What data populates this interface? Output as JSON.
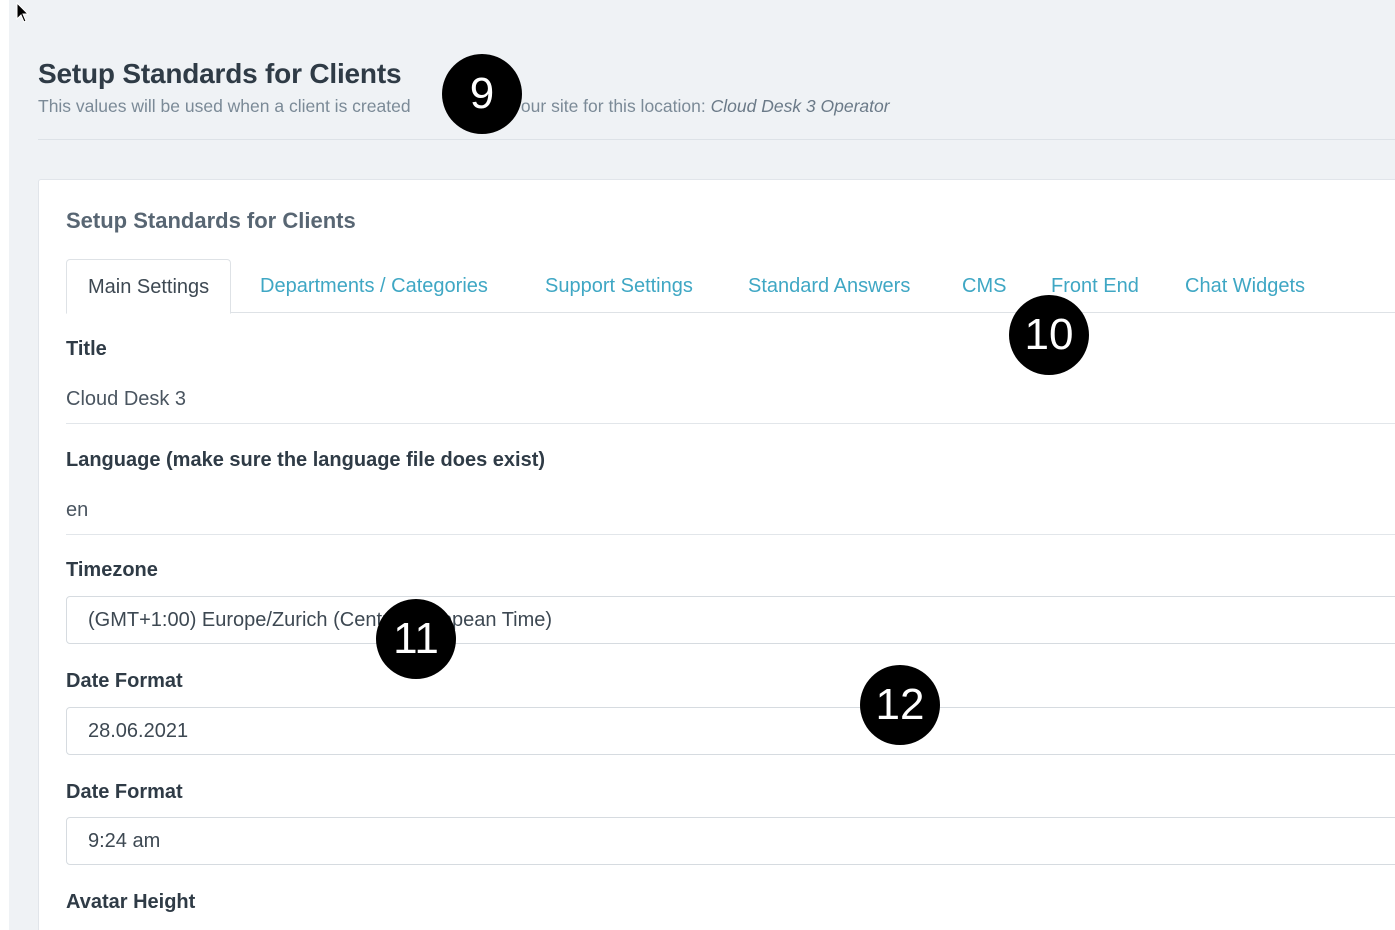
{
  "header": {
    "title": "Setup Standards for Clients",
    "subtitle_prefix": "This values will be used when a client is created",
    "subtitle_hidden_gap": "",
    "subtitle_suffix": "ter on your site for this location:",
    "location_name": "Cloud Desk 3 Operator"
  },
  "card": {
    "title": "Setup Standards for Clients",
    "tabs": [
      {
        "label": "Main Settings",
        "active": true
      },
      {
        "label": "Departments / Categories",
        "active": false
      },
      {
        "label": "Support Settings",
        "active": false
      },
      {
        "label": "Standard Answers",
        "active": false
      },
      {
        "label": "CMS",
        "active": false
      },
      {
        "label": "Front End",
        "active": false
      },
      {
        "label": "Chat Widgets",
        "active": false
      }
    ]
  },
  "form": {
    "title_label": "Title",
    "title_value": "Cloud Desk 3",
    "language_label": "Language (make sure the language file does exist)",
    "language_value": "en",
    "timezone_label": "Timezone",
    "timezone_value": "(GMT+1:00) Europe/Zurich (Central European Time)",
    "date_format_label": "Date Format",
    "date_format_value": "28.06.2021",
    "time_format_label": "Date Format",
    "time_format_value": "9:24 am",
    "avatar_height_label": "Avatar Height"
  },
  "markers": [
    "9",
    "10",
    "11",
    "12"
  ],
  "colors": {
    "background": "#eff2f5",
    "link": "#3fa7c4",
    "marker": "#000000"
  },
  "icons": [
    "mouse-pointer-icon"
  ]
}
